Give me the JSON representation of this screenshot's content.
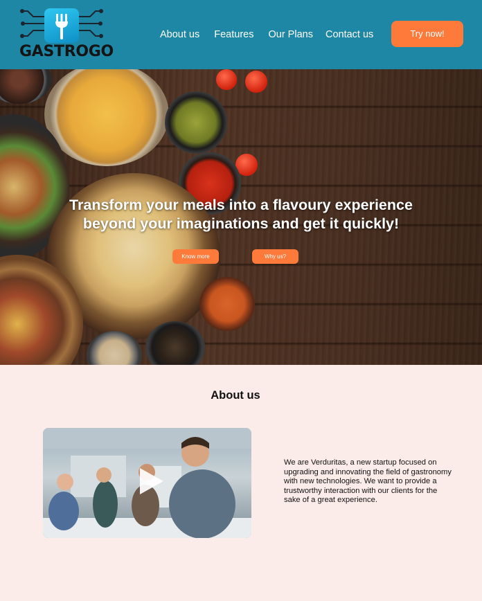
{
  "brand": {
    "name": "GASTROGO"
  },
  "nav": {
    "items": [
      "About us",
      "Features",
      "Our Plans",
      "Contact us"
    ],
    "cta_label": "Try now!"
  },
  "hero": {
    "title_line1": "Transform your meals into a flavoury experience",
    "title_line2": "beyond your imaginations and get it quickly!",
    "know_more_label": "Know more",
    "why_us_label": "Why us?"
  },
  "about": {
    "title": "About us",
    "text": "We are Verduritas, a new startup focused on upgrading and innovating the field of gastronomy with new technologies. We want to provide a trustworthy interaction with our clients for the sake of a great experience."
  },
  "colors": {
    "header_bg": "#1f87a6",
    "accent": "#fd7a3b",
    "page_bg": "#fbecea"
  }
}
